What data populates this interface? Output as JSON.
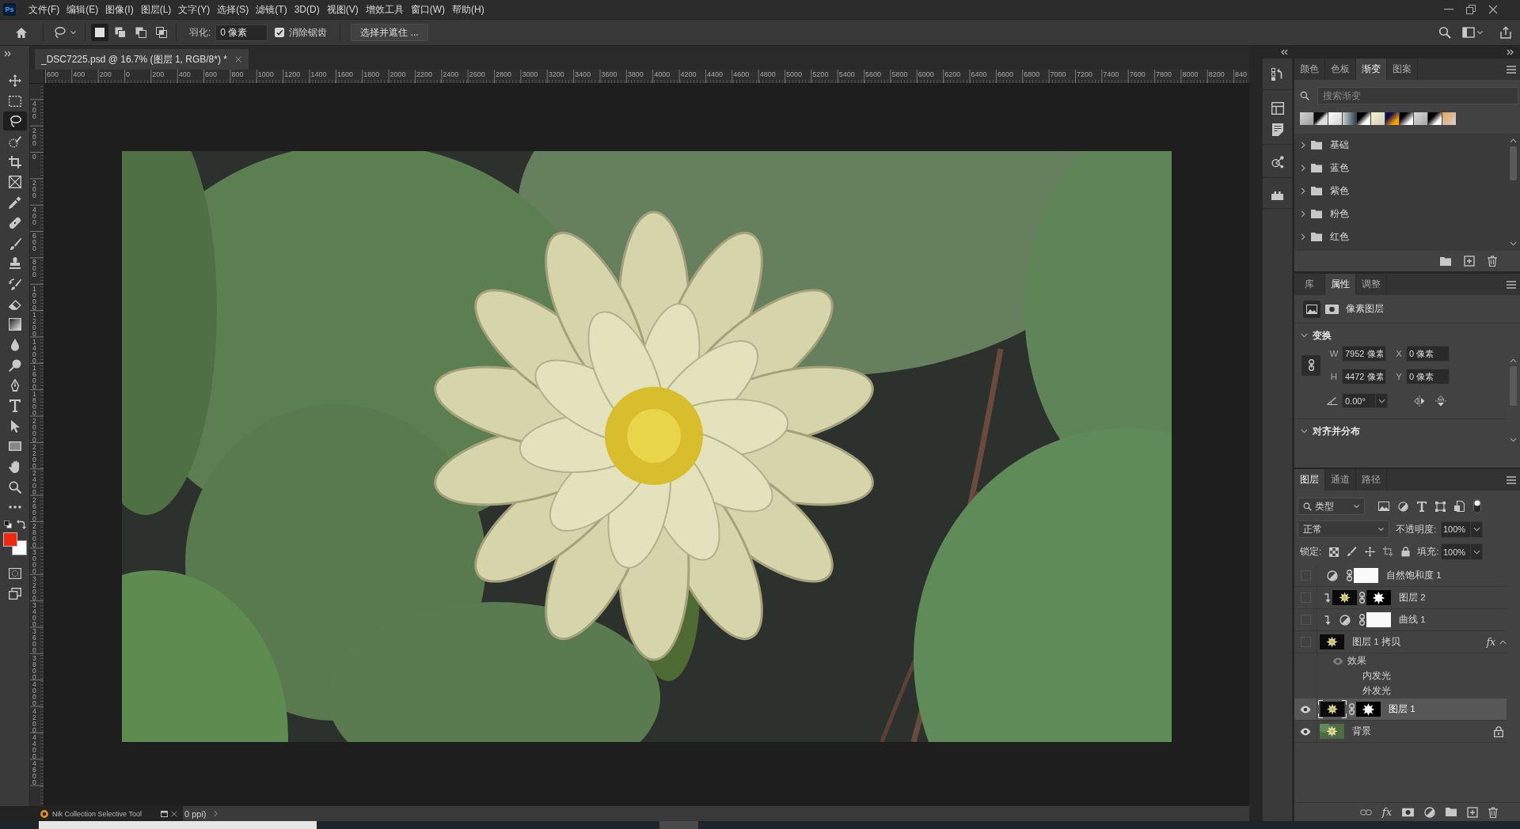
{
  "menu_bar": {
    "logo": "Ps",
    "items": [
      "文件(F)",
      "编辑(E)",
      "图像(I)",
      "图层(L)",
      "文字(Y)",
      "选择(S)",
      "滤镜(T)",
      "3D(D)",
      "视图(V)",
      "增效工具",
      "窗口(W)",
      "帮助(H)"
    ]
  },
  "options_bar": {
    "selection_modes": [
      {
        "selected": true
      },
      {
        "selected": false
      },
      {
        "selected": false
      },
      {
        "selected": false
      }
    ],
    "feather": {
      "label": "羽化:",
      "value": "0 像素"
    },
    "anti_alias": {
      "label": "消除锯齿",
      "checked": true
    },
    "select_and_mask": "选择并遮住 ..."
  },
  "toolbar": {
    "tools": [
      {
        "kind": "move",
        "selected": false
      },
      {
        "kind": "marquee",
        "selected": false
      },
      {
        "kind": "lasso",
        "selected": true
      },
      {
        "kind": "quickselect",
        "selected": false
      },
      {
        "kind": "crop",
        "selected": false
      },
      {
        "kind": "frame",
        "selected": false
      },
      {
        "kind": "eyedropper",
        "selected": false
      },
      {
        "kind": "healing",
        "selected": false
      },
      {
        "kind": "brush",
        "selected": false
      },
      {
        "kind": "stamp",
        "selected": false
      },
      {
        "kind": "historybrush",
        "selected": false
      },
      {
        "kind": "eraser",
        "selected": false
      },
      {
        "kind": "gradient",
        "selected": false
      },
      {
        "kind": "blur",
        "selected": false
      },
      {
        "kind": "dodge",
        "selected": false
      },
      {
        "kind": "pen",
        "selected": false
      },
      {
        "kind": "type",
        "selected": false
      },
      {
        "kind": "pathselect",
        "selected": false
      },
      {
        "kind": "rectangle",
        "selected": false
      },
      {
        "kind": "hand",
        "selected": false
      },
      {
        "kind": "zoom",
        "selected": false
      },
      {
        "kind": "more",
        "selected": false
      }
    ],
    "foreground": {
      "color": "#f2260f"
    },
    "background": {
      "color": "#ffffff"
    }
  },
  "document": {
    "tab": "_DSC7225.psd @ 16.7% (图层 1, RGB/8*) *"
  },
  "rulers": {
    "horizontal": [
      "600",
      "400",
      "200",
      "0",
      "200",
      "400",
      "600",
      "800",
      "1000",
      "1200",
      "1400",
      "1600",
      "1800",
      "2000",
      "2200",
      "2400",
      "2600",
      "2800",
      "3000",
      "3200",
      "3400",
      "3600",
      "3800",
      "4000",
      "4200",
      "4400",
      "4600",
      "4800",
      "5000",
      "5200",
      "5400",
      "5600",
      "5800",
      "6000",
      "6200",
      "6400",
      "6600",
      "6800",
      "7000",
      "7200",
      "7400",
      "7600",
      "7800",
      "8000",
      "8200",
      "840"
    ],
    "vertical": [
      "400",
      "200",
      "0",
      "200",
      "400",
      "600",
      "800",
      "1000",
      "1200",
      "1400",
      "1600",
      "1800",
      "2000",
      "2200",
      "2400",
      "2600",
      "2800",
      "3000",
      "3200",
      "3400",
      "3600",
      "3800",
      "4000",
      "4200",
      "4400",
      "4600"
    ]
  },
  "status_bar": {
    "floating_panel": "Nik Collection Selective Tool",
    "info": "0 ppi)"
  },
  "gradients_panel": {
    "tabs": [
      {
        "label": "颜色",
        "selected": false
      },
      {
        "label": "色板",
        "selected": false
      },
      {
        "label": "渐变",
        "selected": true
      },
      {
        "label": "图案",
        "selected": false
      }
    ],
    "search": {
      "placeholder": "搜索渐变"
    },
    "folders": [
      {
        "name": "基础",
        "expanded": false
      },
      {
        "name": "蓝色",
        "expanded": false
      },
      {
        "name": "紫色",
        "expanded": false
      },
      {
        "name": "粉色",
        "expanded": false
      },
      {
        "name": "红色",
        "expanded": false
      }
    ]
  },
  "properties_panel": {
    "tabs": [
      {
        "label": "库",
        "selected": false
      },
      {
        "label": "属性",
        "selected": true
      },
      {
        "label": "调整",
        "selected": false
      }
    ],
    "layer_type": "像素图层",
    "transform": {
      "title": "变换",
      "expanded": true,
      "fields": [
        {
          "label": "W",
          "value": "7952 像素"
        },
        {
          "label": "X",
          "value": "0 像素"
        },
        {
          "label": "H",
          "value": "4472 像素"
        },
        {
          "label": "Y",
          "value": "0 像素"
        }
      ],
      "angle": "0.00°"
    },
    "align": {
      "title": "对齐并分布",
      "expanded": true
    }
  },
  "layers_panel": {
    "tabs": [
      {
        "label": "图层",
        "selected": true
      },
      {
        "label": "通道",
        "selected": false
      },
      {
        "label": "路径",
        "selected": false
      }
    ],
    "filter": "类型",
    "blend_mode": "正常",
    "opacity": {
      "label": "不透明度:",
      "value": "100%"
    },
    "lock_label": "锁定:",
    "fill": {
      "label": "填充:",
      "value": "100%"
    },
    "footer_fx": "fx",
    "layers": [
      {
        "name": "自然饱和度 1",
        "kind": "adjustment",
        "visible": false,
        "selected": false,
        "clipped": false,
        "masked": true,
        "locked": false
      },
      {
        "name": "图层 2",
        "kind": "pixel",
        "visible": false,
        "selected": false,
        "clipped": true,
        "masked": true,
        "locked": false
      },
      {
        "name": "曲线 1",
        "kind": "adjustment",
        "visible": false,
        "selected": false,
        "clipped": true,
        "masked": true,
        "locked": false
      },
      {
        "name": "图层 1 拷贝",
        "kind": "pixel",
        "visible": false,
        "selected": false,
        "clipped": false,
        "masked": false,
        "locked": false,
        "effects": {
          "badge": "fx",
          "label": "效果",
          "visible": true,
          "expanded": true,
          "items": [
            "内发光",
            "外发光"
          ]
        }
      },
      {
        "name": "图层 1",
        "kind": "pixel",
        "visible": true,
        "selected": true,
        "clipped": false,
        "masked": true,
        "locked": false
      },
      {
        "name": "背景",
        "kind": "background",
        "visible": true,
        "selected": false,
        "clipped": false,
        "masked": false,
        "locked": true
      }
    ]
  }
}
